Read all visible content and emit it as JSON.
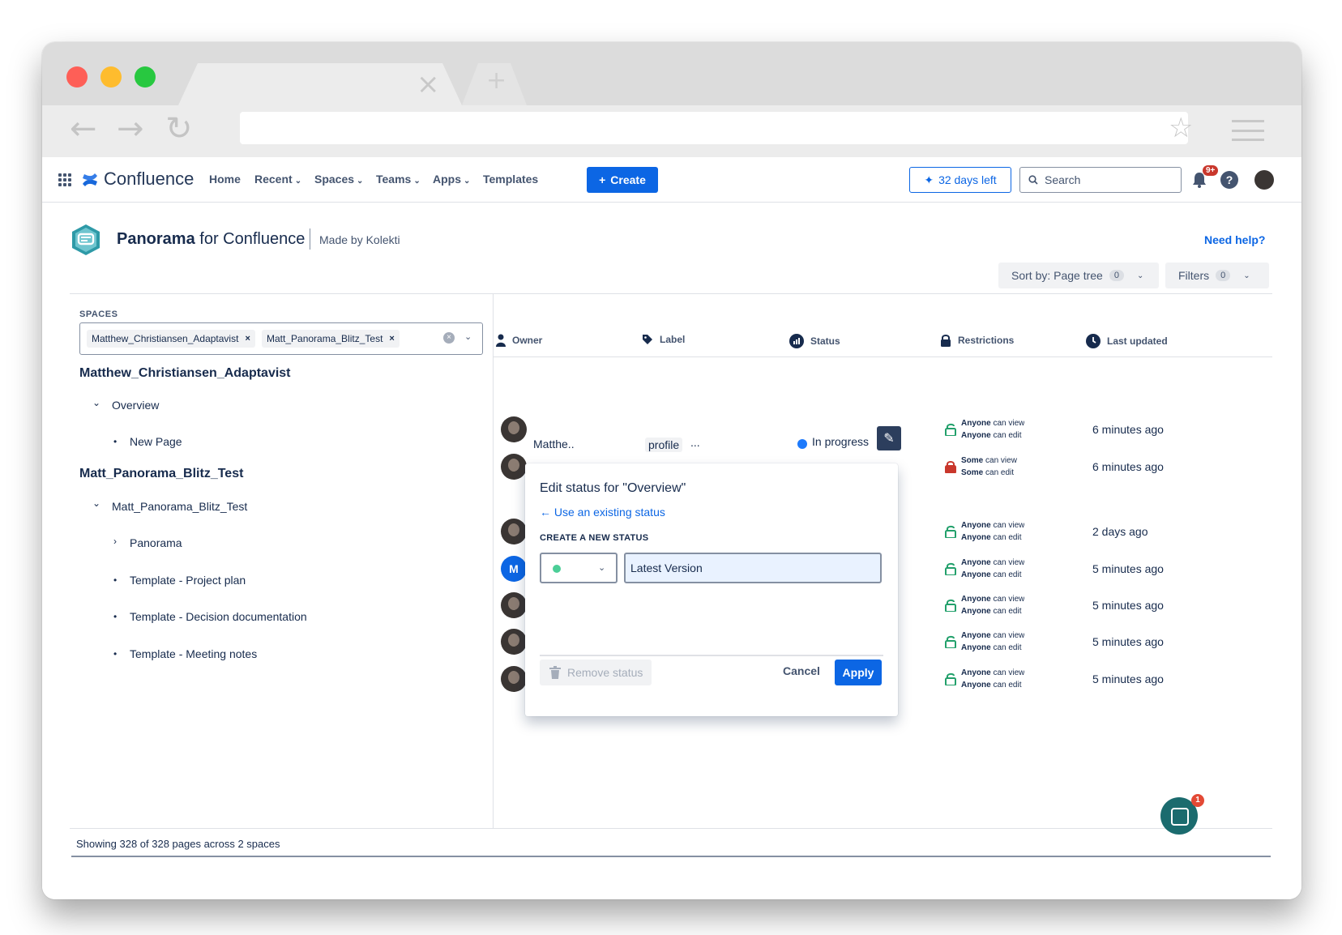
{
  "window": {
    "tab_close": "×",
    "tab_new": "+",
    "back_icon": "←",
    "forward_icon": "→",
    "reload_icon": "↻",
    "star_icon": "☆"
  },
  "topnav": {
    "brand": "Confluence",
    "items": [
      {
        "label": "Home",
        "chevron": ""
      },
      {
        "label": "Recent",
        "chevron": "⌄"
      },
      {
        "label": "Spaces",
        "chevron": "⌄"
      },
      {
        "label": "Teams",
        "chevron": "⌄"
      },
      {
        "label": "Apps",
        "chevron": "⌄"
      },
      {
        "label": "Templates",
        "chevron": ""
      }
    ],
    "create_label": "Create",
    "trial_label": "32 days left",
    "search_placeholder": "Search",
    "notification_badge": "9+",
    "help_glyph": "?"
  },
  "panorama": {
    "title_bold": "Panorama",
    "title_rest": " for Confluence",
    "made_by": "Made by Kolekti",
    "need_help": "Need help?",
    "sort_label": "Sort by: Page tree",
    "sort_count": "0",
    "filters_label": "Filters",
    "filters_count": "0"
  },
  "left_panel": {
    "spaces_label": "SPACES",
    "chips": [
      "Matthew_Christiansen_Adaptavist",
      "Matt_Panorama_Blitz_Test"
    ],
    "tree": [
      {
        "type": "space",
        "label": "Matthew_Christiansen_Adaptavist"
      },
      {
        "type": "item",
        "mark": "⌄",
        "label": "Overview"
      },
      {
        "type": "item",
        "mark": "•",
        "label": "New Page"
      },
      {
        "type": "space",
        "label": "Matt_Panorama_Blitz_Test"
      },
      {
        "type": "item",
        "mark": "⌄",
        "label": "Matt_Panorama_Blitz_Test"
      },
      {
        "type": "item",
        "mark": "›",
        "label": "Panorama"
      },
      {
        "type": "item",
        "mark": "•",
        "label": "Template - Project plan"
      },
      {
        "type": "item",
        "mark": "•",
        "label": "Template - Decision documentation"
      },
      {
        "type": "item",
        "mark": "•",
        "label": "Template - Meeting notes"
      }
    ]
  },
  "table": {
    "headers": [
      "Owner",
      "Label",
      "Status",
      "Restrictions",
      "Last updated"
    ],
    "first_row": {
      "owner": "Matthe..",
      "label": "profile",
      "label_more": "...",
      "status": "In progress",
      "status_color": "#1d7afc"
    },
    "rows": [
      {
        "avatar": "photo",
        "r1_bold": "Anyone",
        "r1": " can view",
        "r2_bold": "Anyone",
        "r2": " can edit",
        "lock": "open",
        "updated": "6 minutes ago"
      },
      {
        "avatar": "photo",
        "r1_bold": "Some",
        "r1": " can view",
        "r2_bold": "Some",
        "r2": " can edit",
        "lock": "closed",
        "updated": "6 minutes ago"
      },
      {
        "avatar": "photo",
        "r1_bold": "Anyone",
        "r1": " can view",
        "r2_bold": "Anyone",
        "r2": " can edit",
        "lock": "open",
        "updated": "2 days ago"
      },
      {
        "avatar": "M",
        "r1_bold": "Anyone",
        "r1": " can view",
        "r2_bold": "Anyone",
        "r2": " can edit",
        "lock": "open",
        "updated": "5 minutes ago"
      },
      {
        "avatar": "photo",
        "r1_bold": "Anyone",
        "r1": " can view",
        "r2_bold": "Anyone",
        "r2": " can edit",
        "lock": "open",
        "updated": "5 minutes ago"
      },
      {
        "avatar": "photo",
        "r1_bold": "Anyone",
        "r1": " can view",
        "r2_bold": "Anyone",
        "r2": " can edit",
        "lock": "open",
        "updated": "5 minutes ago"
      },
      {
        "avatar": "photo",
        "r1_bold": "Anyone",
        "r1": " can view",
        "r2_bold": "Anyone",
        "r2": " can edit",
        "lock": "open",
        "updated": "5 minutes ago"
      }
    ]
  },
  "popover": {
    "title": "Edit status for \"Overview\"",
    "back_link": "Use an existing status",
    "section_label": "CREATE A NEW STATUS",
    "color_value": "#4bce97",
    "name_value": "Latest Version",
    "remove_label": "Remove status",
    "cancel_label": "Cancel",
    "apply_label": "Apply"
  },
  "footer": {
    "text": "Showing 328 of 328 pages across 2 spaces"
  },
  "chat": {
    "badge": "1"
  }
}
